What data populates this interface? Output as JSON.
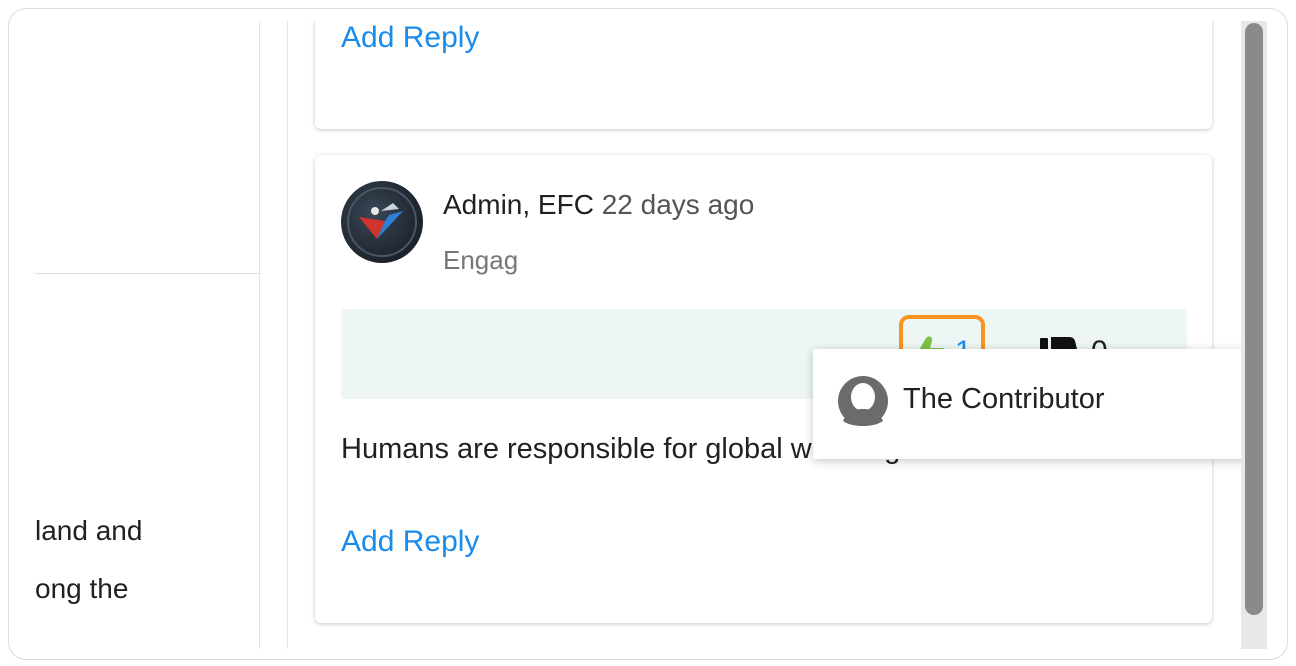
{
  "left_panel": {
    "text_lines": [
      "land and",
      "ong the"
    ]
  },
  "top_card": {
    "add_reply_label": "Add Reply"
  },
  "comment": {
    "author": "Admin, EFC",
    "time_ago": "22 days ago",
    "subtitle_partial": "Engag",
    "likes": "1",
    "dislikes": "0",
    "body": "Humans are responsible for global warming.",
    "add_reply_label": "Add Reply"
  },
  "tooltip": {
    "user_name": "The Contributor"
  },
  "colors": {
    "link_blue": "#1a8bea",
    "highlight_orange": "#f7931e",
    "like_green": "#7cc242",
    "vote_bar_bg": "#edf6f5"
  },
  "icons": {
    "like": "thumbs-up-icon",
    "dislike": "thumbs-down-icon",
    "user_placeholder": "user-avatar-icon"
  }
}
